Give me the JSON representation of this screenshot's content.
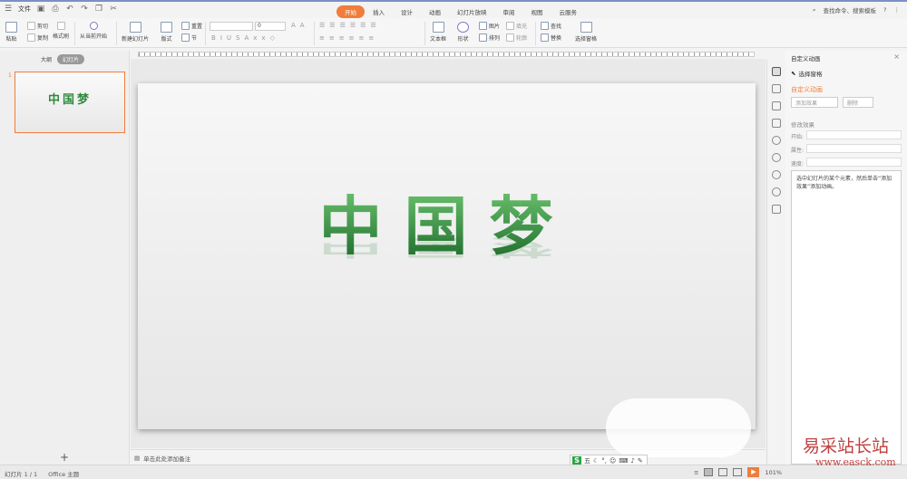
{
  "titlebar": {
    "file_menu": "文件",
    "search_placeholder": "查找命令、搜索模板",
    "help": "?",
    "tabs": [
      {
        "label": "开始",
        "active": true
      },
      {
        "label": "插入"
      },
      {
        "label": "设计"
      },
      {
        "label": "动画"
      },
      {
        "label": "幻灯片放映"
      },
      {
        "label": "审阅"
      },
      {
        "label": "视图"
      },
      {
        "label": "云服务"
      }
    ]
  },
  "ribbon": {
    "paste": "粘贴",
    "cut": "剪切",
    "copy": "复制",
    "format_painter": "格式刷",
    "play_from_current": "从当前开始",
    "new_slide": "新建幻灯片",
    "layout": "版式",
    "reset": "重置",
    "section": "节",
    "font_size": "0",
    "textbox": "文本框",
    "shape": "形状",
    "picture": "图片",
    "arrange": "排列",
    "fill": "填充",
    "outline": "轮廓",
    "find": "查找",
    "replace": "替换",
    "select_pane": "选择窗格"
  },
  "left_panel": {
    "tab_outline": "大纲",
    "tab_slides": "幻灯片",
    "slide_number": "1",
    "thumb_title": "中国梦",
    "add": "+"
  },
  "slide": {
    "title": "中国梦",
    "accent": "#2e8a3d"
  },
  "notes": {
    "placeholder": "单击此处添加备注"
  },
  "ime": {
    "logo": "S",
    "mode": "五"
  },
  "right_panel": {
    "title": "自定义动画",
    "select_pane": "选择窗格",
    "heading": "自定义动画",
    "add_effect": "添加效果",
    "delete": "删除",
    "modify_heading": "修改效果",
    "start_label": "开始:",
    "property_label": "属性:",
    "speed_label": "速度:",
    "hint": "选中幻灯片的某个元素，然后单击“添加效果”添加动画。"
  },
  "statusbar": {
    "slide_info": "幻灯片 1 / 1",
    "theme": "Office 主题",
    "zoom": "101%"
  },
  "watermark": {
    "site_name": "易采站长站",
    "url": "www.easck.com"
  }
}
